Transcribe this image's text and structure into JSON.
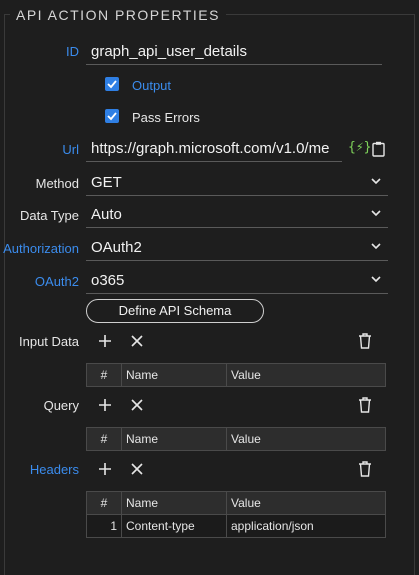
{
  "section_title": "API ACTION PROPERTIES",
  "id": {
    "label": "ID",
    "value": "graph_api_user_details"
  },
  "output": {
    "label": "Output",
    "checked": true
  },
  "pass_errors": {
    "label": "Pass Errors",
    "checked": true
  },
  "url": {
    "label": "Url",
    "value": "https://graph.microsoft.com/v1.0/me",
    "icons": [
      "lightning-icon",
      "clipboard-icon"
    ]
  },
  "method": {
    "label": "Method",
    "value": "GET"
  },
  "data_type": {
    "label": "Data Type",
    "value": "Auto"
  },
  "authorization": {
    "label": "Authorization",
    "value": "OAuth2"
  },
  "oauth2": {
    "label": "OAuth2",
    "value": "o365"
  },
  "define_schema_button": "Define API Schema",
  "input_data": {
    "label": "Input Data",
    "columns": [
      "#",
      "Name",
      "Value"
    ],
    "rows": []
  },
  "query": {
    "label": "Query",
    "columns": [
      "#",
      "Name",
      "Value"
    ],
    "rows": []
  },
  "headers": {
    "label": "Headers",
    "columns": [
      "#",
      "Name",
      "Value"
    ],
    "rows": [
      {
        "num": "1",
        "name": "Content-type",
        "value": "application/json"
      }
    ]
  },
  "colors": {
    "accent": "#3b8ced",
    "checkbox": "#2f7fe4",
    "background": "#1e1e1e",
    "lightning": "#7fd35a"
  }
}
